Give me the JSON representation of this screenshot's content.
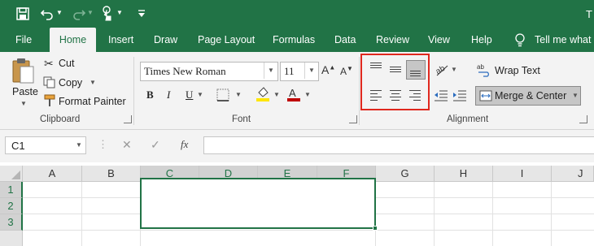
{
  "colors": {
    "brand": "#217346",
    "highlight_box": "#e0281e",
    "font_color_red": "#c00000",
    "fill_yellow": "#ffe600"
  },
  "title_bar": {
    "title_fragment": "T",
    "icons": [
      "save-icon",
      "undo-icon",
      "redo-icon",
      "touch-mode-icon",
      "customize-qat-icon"
    ]
  },
  "tabs": [
    "File",
    "Home",
    "Insert",
    "Draw",
    "Page Layout",
    "Formulas",
    "Data",
    "Review",
    "View",
    "Help"
  ],
  "tell_me": "Tell me what s",
  "clipboard": {
    "paste": "Paste",
    "cut": "Cut",
    "copy": "Copy",
    "format_painter": "Format Painter",
    "label": "Clipboard"
  },
  "font": {
    "name": "Times New Roman",
    "size": "11",
    "bold": "B",
    "italic": "I",
    "underline": "U",
    "label": "Font"
  },
  "alignment": {
    "wrap_text": "Wrap Text",
    "merge_center": "Merge & Center",
    "label": "Alignment"
  },
  "formula_bar": {
    "name_box": "C1",
    "fx": "fx",
    "value": ""
  },
  "columns": [
    "A",
    "B",
    "C",
    "D",
    "E",
    "F",
    "G",
    "H",
    "I",
    "J"
  ],
  "rows": [
    "1",
    "2",
    "3"
  ],
  "selected_range": "C1:F3"
}
